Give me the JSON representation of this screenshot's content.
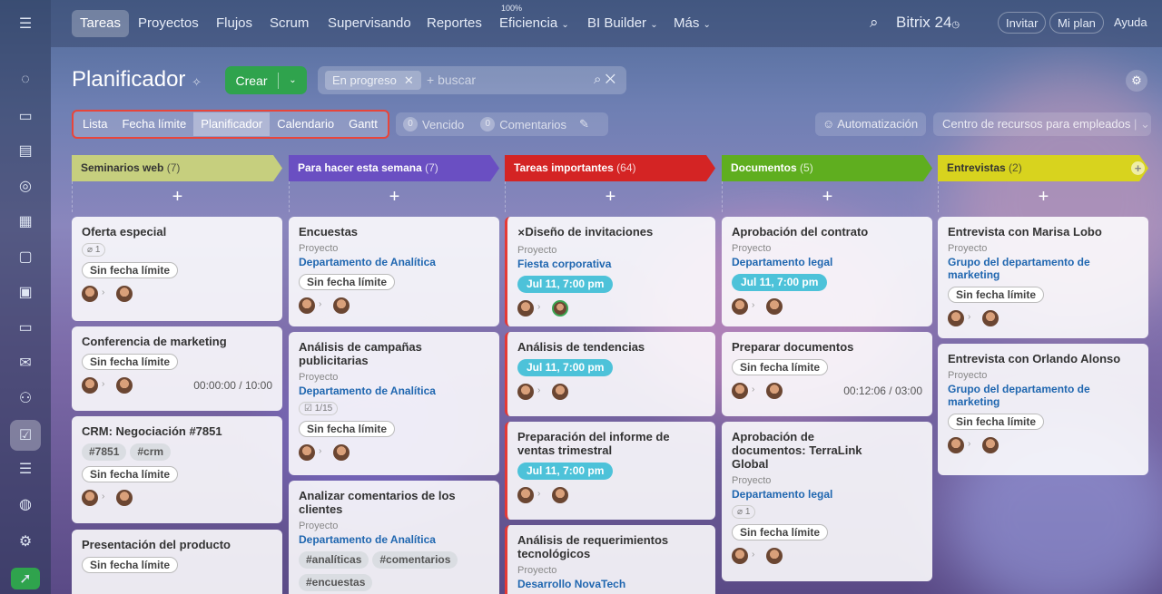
{
  "topnav": {
    "items": [
      "Tareas",
      "Proyectos",
      "Flujos",
      "Scrum",
      "Supervisando",
      "Reportes",
      "Eficiencia",
      "BI Builder",
      "Más"
    ],
    "efficiency_pct": "100%",
    "brand": "Bitrix 24",
    "invite": "Invitar",
    "plan": "Mi plan",
    "help": "Ayuda"
  },
  "page": {
    "title": "Planificador",
    "create": "Crear",
    "filter_chip": "En progreso",
    "search_placeholder": "+ buscar"
  },
  "views": [
    "Lista",
    "Fecha límite",
    "Planificador",
    "Calendario",
    "Gantt"
  ],
  "counters": {
    "overdue_count": "0",
    "overdue_label": "Vencido",
    "comments_count": "0",
    "comments_label": "Comentarios"
  },
  "automation": "Automatización",
  "resources": "Centro de recursos para empleados",
  "columns": [
    {
      "title": "Seminarios web",
      "count": "(7)",
      "color": "#c6cf7e",
      "text": "#333",
      "cards": [
        {
          "title": "Oferta especial",
          "counter": "1",
          "badge": "Sin fecha límite"
        },
        {
          "title": "Conferencia de marketing",
          "badge": "Sin fecha límite",
          "timer": "00:00:00 / 10:00"
        },
        {
          "title": "CRM: Negociación #7851",
          "tags": [
            "#7851",
            "#crm"
          ],
          "badge": "Sin fecha límite"
        },
        {
          "title": "Presentación del producto",
          "badge": "Sin fecha límite"
        }
      ]
    },
    {
      "title": "Para hacer esta semana",
      "count": "(7)",
      "color": "#6a4fc2",
      "text": "#fff",
      "cards": [
        {
          "title": "Encuestas",
          "project": "Proyecto",
          "link": "Departamento de Analítica",
          "badge": "Sin fecha límite"
        },
        {
          "title": "Análisis de campañas publicitarias",
          "project": "Proyecto",
          "link": "Departamento de Analítica",
          "checklist": "1/15",
          "badge": "Sin fecha límite"
        },
        {
          "title": "Analizar comentarios de los clientes",
          "project": "Proyecto",
          "link": "Departamento de Analítica",
          "tags": [
            "#analíticas",
            "#comentarios",
            "#encuestas"
          ]
        }
      ]
    },
    {
      "title": "Tareas importantes",
      "count": "(64)",
      "color": "#d42424",
      "text": "#fff",
      "cards": [
        {
          "title": "Diseño de invitaciones",
          "project": "Proyecto",
          "link": "Fiesta corporativa",
          "deadline": "Jul 11, 7:00 pm"
        },
        {
          "title": "Análisis de tendencias",
          "deadline": "Jul 11, 7:00 pm"
        },
        {
          "title": "Preparación del informe de ventas trimestral",
          "deadline": "Jul 11, 7:00 pm"
        },
        {
          "title": "Análisis de requerimientos tecnológicos",
          "project": "Proyecto",
          "link": "Desarrollo NovaTech"
        }
      ]
    },
    {
      "title": "Documentos",
      "count": "(5)",
      "color": "#5fae1f",
      "text": "#fff",
      "cards": [
        {
          "title": "Aprobación del contrato",
          "project": "Proyecto",
          "link": "Departamento legal",
          "deadline": "Jul 11, 7:00 pm"
        },
        {
          "title": "Preparar documentos",
          "badge": "Sin fecha límite",
          "timer": "00:12:06 / 03:00"
        },
        {
          "title": "Aprobación de documentos: TerraLink Global",
          "project": "Proyecto",
          "link": "Departamento legal",
          "counter": "1",
          "badge": "Sin fecha límite"
        }
      ]
    },
    {
      "title": "Entrevistas",
      "count": "(2)",
      "color": "#d8d31e",
      "text": "#333",
      "cards": [
        {
          "title": "Entrevista con Marisa Lobo",
          "project": "Proyecto",
          "link": "Grupo del departamento de marketing",
          "badge": "Sin fecha límite"
        },
        {
          "title": "Entrevista con Orlando Alonso",
          "project": "Proyecto",
          "link": "Grupo del departamento de marketing",
          "badge": "Sin fecha límite"
        }
      ]
    }
  ]
}
